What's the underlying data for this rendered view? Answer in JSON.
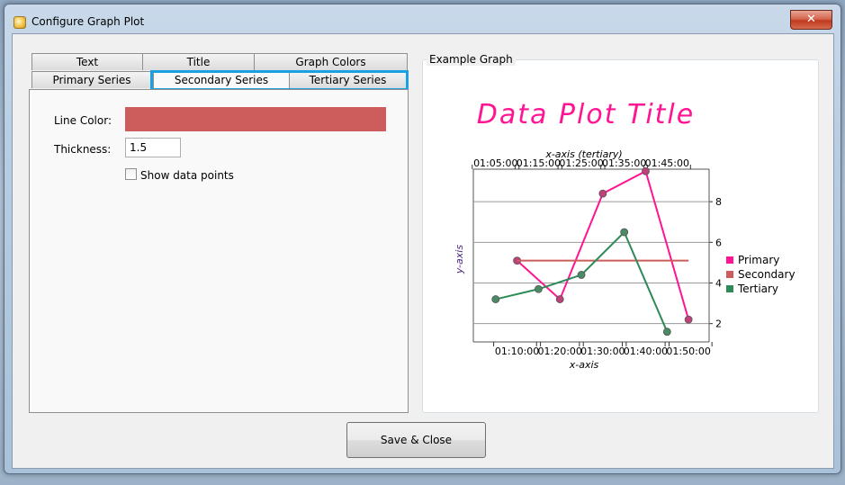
{
  "window": {
    "title": "Configure Graph Plot",
    "close_symbol": "✕"
  },
  "tabs": {
    "row1": [
      {
        "label": "Text"
      },
      {
        "label": "Title"
      },
      {
        "label": "Graph Colors"
      }
    ],
    "row2": [
      {
        "label": "Primary Series"
      },
      {
        "label": "Secondary Series"
      },
      {
        "label": "Tertiary Series"
      }
    ],
    "active": "Secondary Series"
  },
  "settings": {
    "line_color_label": "Line Color:",
    "line_color_value": "#cd5c5c",
    "thickness_label": "Thickness:",
    "thickness_value": "1.5",
    "show_points_label": "Show data points",
    "show_points_checked": false
  },
  "example_graph": {
    "group_label": "Example Graph",
    "title": "Data Plot Title",
    "title_color": "#ff1493"
  },
  "chart_data": {
    "type": "line",
    "title": "Data Plot Title",
    "xlabel": "x-axis",
    "x2label": "x-axis (tertiary)",
    "ylabel": "y-axis",
    "x_ticks": [
      "01:10:00",
      "01:20:00",
      "01:30:00",
      "01:40:00",
      "01:50:00"
    ],
    "x2_ticks": [
      "01:05:00",
      "01:15:00",
      "01:25:00",
      "01:35:00",
      "01:45:00"
    ],
    "y_ticks": [
      2,
      4,
      6,
      8
    ],
    "ylim": [
      1.1,
      9.6
    ],
    "grid": true,
    "legend_position": "right",
    "series": [
      {
        "name": "Primary",
        "color": "#ff1493",
        "axis": "x",
        "x": [
          "01:10:00",
          "01:20:00",
          "01:30:00",
          "01:40:00",
          "01:50:00"
        ],
        "values": [
          5.1,
          3.2,
          8.4,
          9.5,
          2.2
        ],
        "points": true
      },
      {
        "name": "Secondary",
        "color": "#cd5c5c",
        "axis": "x",
        "x": [
          "01:10:00",
          "01:50:00"
        ],
        "values": [
          5.1,
          5.1
        ],
        "points": false
      },
      {
        "name": "Tertiary",
        "color": "#2e8b57",
        "axis": "x2",
        "x": [
          "01:05:00",
          "01:15:00",
          "01:25:00",
          "01:35:00",
          "01:45:00"
        ],
        "values": [
          3.2,
          3.7,
          4.4,
          6.5,
          1.6
        ],
        "points": true
      }
    ]
  },
  "buttons": {
    "save_close": "Save & Close"
  }
}
